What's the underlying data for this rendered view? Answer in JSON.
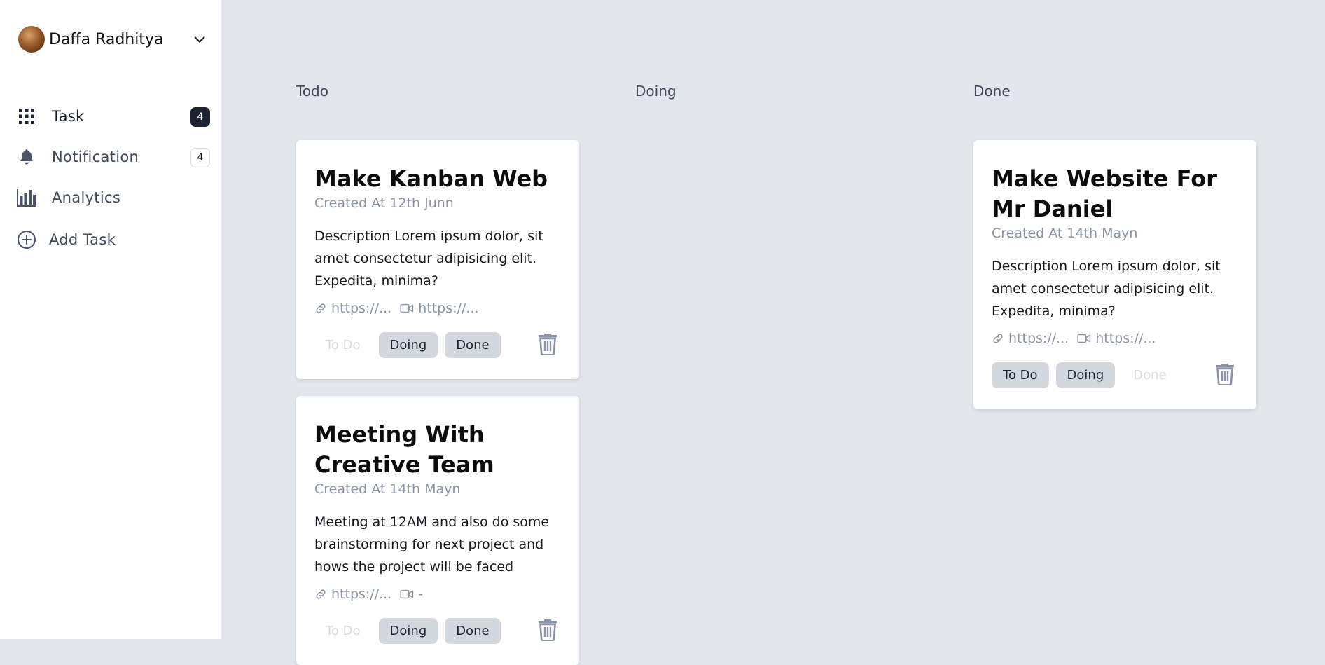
{
  "user": {
    "name": "Daffa Radhitya"
  },
  "nav": [
    {
      "label": "Task",
      "count": "4",
      "icon": "grid-icon"
    },
    {
      "label": "Notification",
      "count": "4",
      "icon": "bell-icon"
    },
    {
      "label": "Analytics",
      "icon": "chart-bar-icon"
    }
  ],
  "add_task": {
    "label": "Add Task",
    "icon": "plus-circle-icon"
  },
  "columns": [
    {
      "title": "Todo"
    },
    {
      "title": "Doing"
    },
    {
      "title": "Done"
    }
  ],
  "buttons": {
    "todo": "To Do",
    "doing": "Doing",
    "done": "Done"
  },
  "cards": [
    {
      "title": "Make Kanban Web",
      "created": "Created At 12th Junn",
      "description": "Description Lorem ipsum dolor, sit amet consectetur adipisicing elit. Expedita, minima?",
      "link": "https://...",
      "video": "https://..."
    },
    {
      "title": "Meeting With Creative Team",
      "created": "Created At 14th Mayn",
      "description": "Meeting at 12AM and also do some brainstorming for next project and hows the project will be faced",
      "link": "https://...",
      "video": "-"
    },
    {
      "title": "Make Website For Mr Daniel",
      "created": "Created At 14th Mayn",
      "description": "Description Lorem ipsum dolor, sit amet consectetur adipisicing elit. Expedita, minima?",
      "link": "https://...",
      "video": "https://..."
    }
  ],
  "colors": {
    "sidebar_bg": "#ffffff",
    "board_bg": "#e3e6ec",
    "badge_dark": "#1d2333",
    "button_bg": "#d3d7de"
  }
}
